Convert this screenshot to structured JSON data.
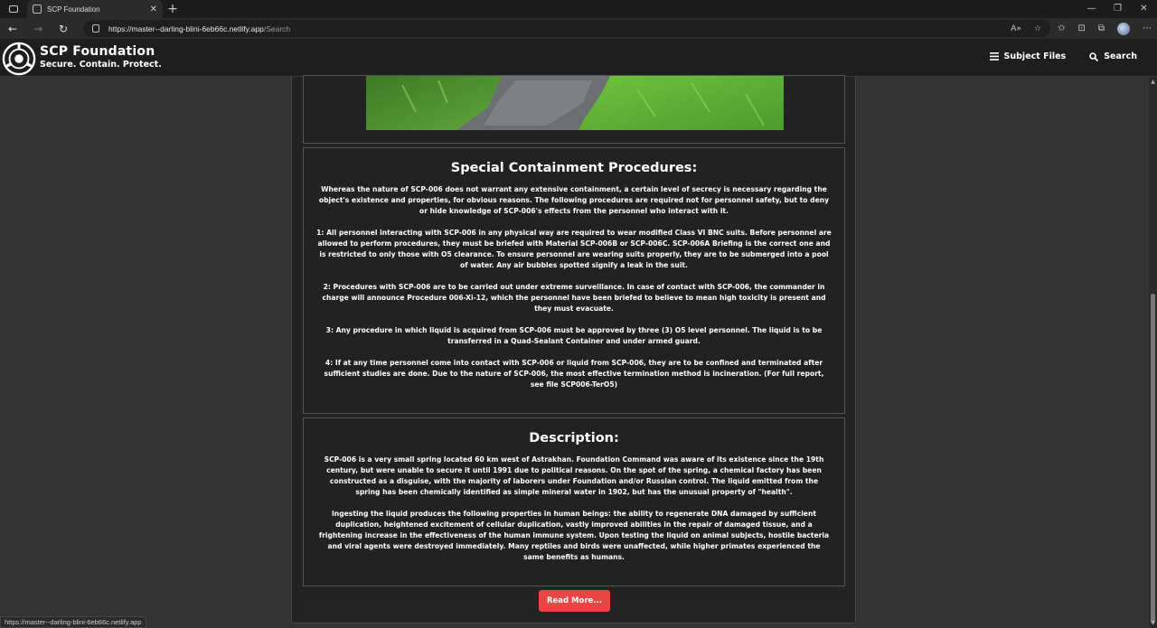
{
  "browser": {
    "tab_title": "SCP Foundation",
    "new_tab": "+",
    "url_host": "https://master--darling-blini-6eb66c.netlify.app",
    "url_path": "/Search",
    "status_url": "https://master--darling-blini-6eb66c.netlify.app"
  },
  "site": {
    "name": "SCP Foundation",
    "tagline": "Secure. Contain. Protect.",
    "nav": {
      "subject_files": "Subject Files",
      "search": "Search"
    }
  },
  "containment": {
    "heading": "Special Containment Procedures:",
    "paragraphs": [
      "Whereas the nature of SCP-006 does not warrant any extensive containment, a certain level of secrecy is necessary regarding the object's existence and properties, for obvious reasons. The following procedures are required not for personnel safety, but to deny or hide knowledge of SCP-006's effects from the personnel who interact with it.",
      "1: All personnel interacting with SCP-006 in any physical way are required to wear modified Class VI BNC suits. Before personnel are allowed to perform procedures, they must be briefed with Material SCP-006B or SCP-006C. SCP-006A Briefing is the correct one and is restricted to only those with O5 clearance. To ensure personnel are wearing suits properly, they are to be submerged into a pool of water. Any air bubbles spotted signify a leak in the suit.",
      "2: Procedures with SCP-006 are to be carried out under extreme surveillance. In case of contact with SCP-006, the commander in charge will announce Procedure 006-Xi-12, which the personnel have been briefed to believe to mean high toxicity is present and they must evacuate.",
      "3: Any procedure in which liquid is acquired from SCP-006 must be approved by three (3) O5 level personnel. The liquid is to be transferred in a Quad-Sealant Container and under armed guard.",
      "4: If at any time personnel come into contact with SCP-006 or liquid from SCP-006, they are to be confined and terminated after sufficient studies are done. Due to the nature of SCP-006, the most effective termination method is incineration. (For full report, see file SCP006-TerO5)"
    ]
  },
  "description": {
    "heading": "Description:",
    "paragraphs": [
      "SCP-006 is a very small spring located 60 km west of Astrakhan. Foundation Command was aware of its existence since the 19th century, but were unable to secure it until 1991 due to political reasons. On the spot of the spring, a chemical factory has been constructed as a disguise, with the majority of laborers under Foundation and/or Russian control. The liquid emitted from the spring has been chemically identified as simple mineral water in 1902, but has the unusual property of \"health\".",
      "Ingesting the liquid produces the following properties in human beings: the ability to regenerate DNA damaged by sufficient duplication, heightened excitement of cellular duplication, vastly improved abilities in the repair of damaged tissue, and a frightening increase in the effectiveness of the human immune system. Upon testing the liquid on animal subjects, hostile bacteria and viral agents were destroyed immediately. Many reptiles and birds were unaffected, while higher primates experienced the same benefits as humans."
    ]
  },
  "read_more": "Read More...",
  "colors": {
    "accent": "#e84545",
    "panel": "#222222",
    "page": "#333333"
  }
}
